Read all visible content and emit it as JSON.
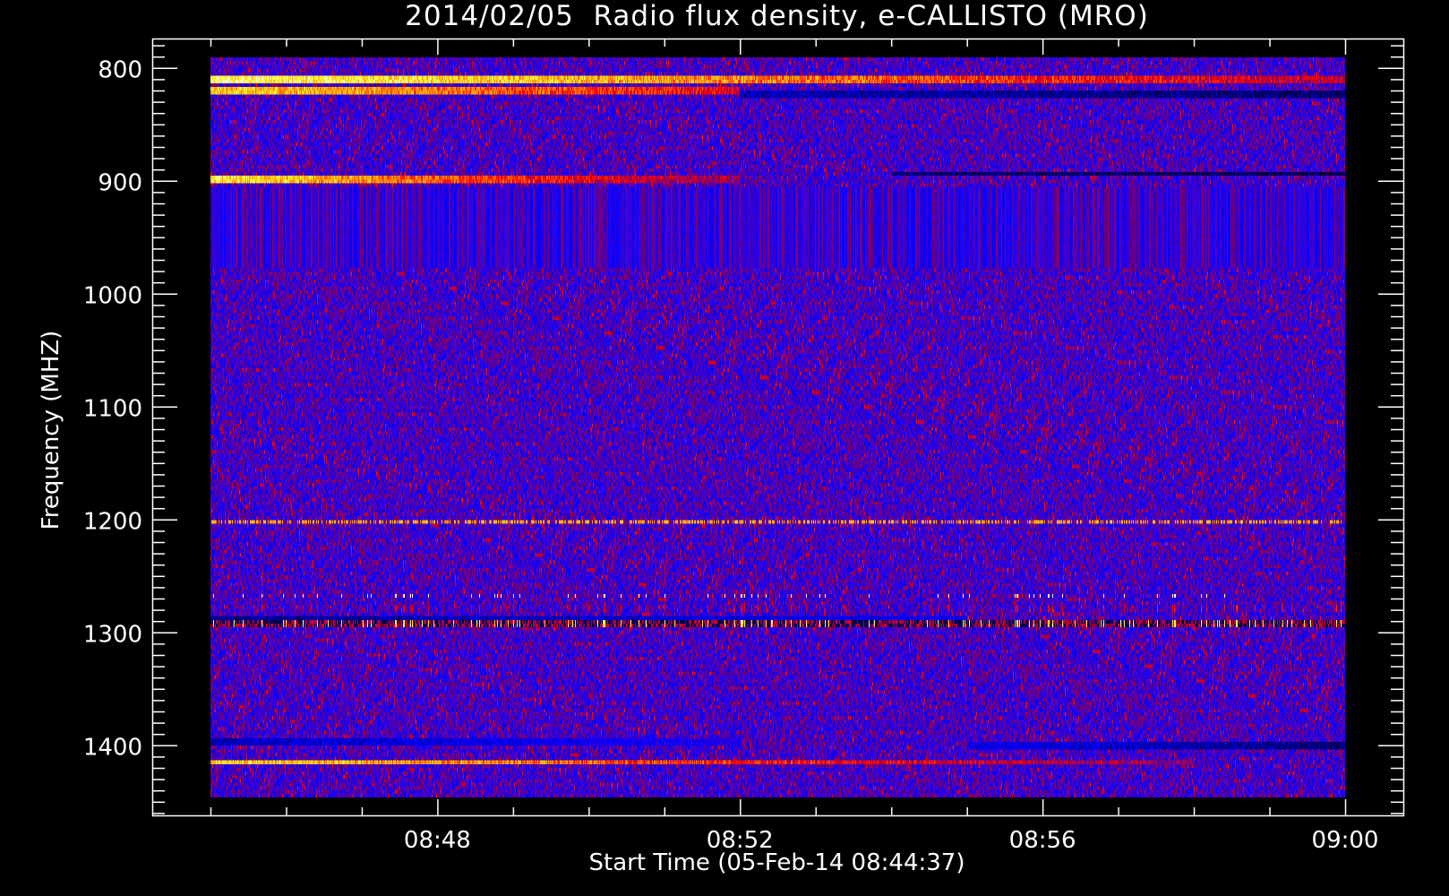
{
  "chart_data": {
    "type": "heatmap",
    "title": "2014/02/05  Radio flux density, e-CALLISTO (MRO)",
    "xlabel": "Start Time (05-Feb-14 08:44:37)",
    "ylabel": "Frequency (MHZ)",
    "x_range_minutes": [
      44.23,
      60.77
    ],
    "x_data_range_minutes": [
      45,
      60
    ],
    "x_ticks": [
      {
        "value": 48,
        "label": "08:48"
      },
      {
        "value": 52,
        "label": "08:52"
      },
      {
        "value": 56,
        "label": "08:56"
      },
      {
        "value": 60,
        "label": "09:00"
      }
    ],
    "x_minor_step_minutes": 1,
    "y_range_mhz": [
      773.6,
      1463.6
    ],
    "y_data_range_mhz": [
      790.5,
      1446
    ],
    "y_inverted": true,
    "y_ticks": [
      {
        "value": 800,
        "label": "800"
      },
      {
        "value": 900,
        "label": "900"
      },
      {
        "value": 1000,
        "label": "1000"
      },
      {
        "value": 1100,
        "label": "1100"
      },
      {
        "value": 1200,
        "label": "1200"
      },
      {
        "value": 1300,
        "label": "1300"
      },
      {
        "value": 1400,
        "label": "1400"
      }
    ],
    "y_minor_step_mhz": 10,
    "colormap": [
      "#000000",
      "#00007f",
      "#0000ff",
      "#3c00d2",
      "#80006a",
      "#ff0000",
      "#ff9a00",
      "#ffff40",
      "#ffffff"
    ],
    "background_level": 0.38,
    "features": [
      {
        "name": "band-810",
        "f0": 806,
        "f1": 813,
        "t0": 45,
        "t1": 60,
        "start_level": 0.9,
        "end_level": 0.55,
        "kind": "emission"
      },
      {
        "name": "band-820",
        "f0": 817,
        "f1": 822,
        "t0": 45,
        "t1": 52,
        "start_level": 0.82,
        "end_level": 0.6,
        "kind": "emission"
      },
      {
        "name": "dark-825",
        "f0": 820,
        "f1": 827,
        "t0": 52,
        "t1": 60,
        "start_level": 0.12,
        "end_level": 0.05,
        "kind": "absorption"
      },
      {
        "name": "band-898",
        "f0": 894,
        "f1": 901,
        "t0": 45,
        "t1": 52,
        "start_level": 0.85,
        "end_level": 0.5,
        "kind": "emission"
      },
      {
        "name": "dark-895",
        "f0": 893,
        "f1": 897,
        "t0": 54,
        "t1": 60,
        "start_level": 0.05,
        "end_level": 0.02,
        "kind": "absorption"
      },
      {
        "name": "striping-910-975",
        "f0": 906,
        "f1": 977,
        "t0": 45,
        "t1": 60,
        "start_level": 0.4,
        "end_level": 0.4,
        "kind": "striped"
      },
      {
        "name": "line-1202",
        "f0": 1200,
        "f1": 1204,
        "t0": 45,
        "t1": 60,
        "start_level": 0.72,
        "end_level": 0.72,
        "kind": "dotted"
      },
      {
        "name": "spikes-1268",
        "f0": 1266,
        "f1": 1270,
        "t0": 45,
        "t1": 58.5,
        "start_level": 0.93,
        "end_level": 0.93,
        "kind": "sparse"
      },
      {
        "name": "bursts-1280",
        "f0": 1277,
        "f1": 1283,
        "t0": 45,
        "t1": 60,
        "start_level": 0.55,
        "end_level": 0.6,
        "kind": "sparse"
      },
      {
        "name": "dark-1287",
        "f0": 1285,
        "f1": 1290,
        "t0": 45,
        "t1": 55,
        "start_level": 0.08,
        "end_level": 0.2,
        "kind": "absorption"
      },
      {
        "name": "bursts-1292",
        "f0": 1288,
        "f1": 1295,
        "t0": 45,
        "t1": 60,
        "start_level": 0.6,
        "end_level": 0.6,
        "kind": "burst"
      },
      {
        "name": "dark-1398",
        "f0": 1395,
        "f1": 1400,
        "t0": 45,
        "t1": 52,
        "start_level": 0.12,
        "end_level": 0.25,
        "kind": "absorption"
      },
      {
        "name": "dark-1401",
        "f0": 1398,
        "f1": 1403,
        "t0": 55,
        "t1": 60,
        "start_level": 0.2,
        "end_level": 0.05,
        "kind": "absorption"
      },
      {
        "name": "band-1415",
        "f0": 1412,
        "f1": 1418,
        "t0": 45,
        "t1": 58,
        "start_level": 0.82,
        "end_level": 0.5,
        "kind": "emission"
      }
    ]
  }
}
